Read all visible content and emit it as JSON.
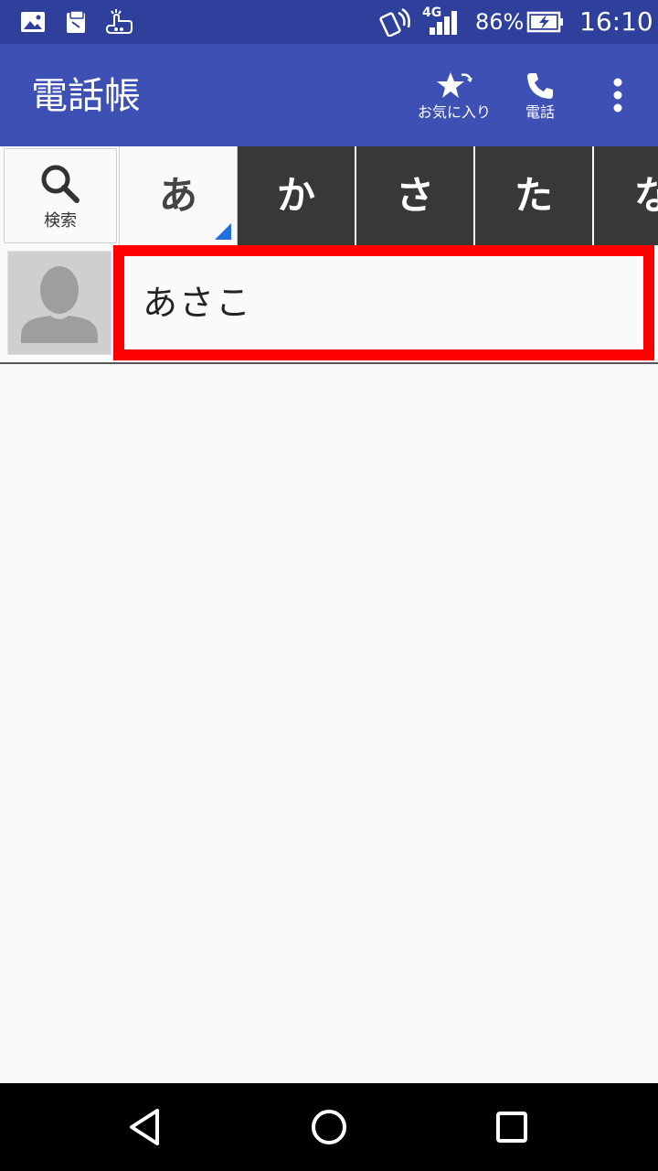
{
  "status": {
    "battery": "86%",
    "network": "4G",
    "time": "16:10"
  },
  "appbar": {
    "title": "電話帳",
    "favorites_label": "お気に入り",
    "phone_label": "電話"
  },
  "index": {
    "search_label": "検索",
    "tabs": [
      "あ",
      "か",
      "さ",
      "た",
      "な"
    ]
  },
  "contacts": [
    {
      "name": "あさこ"
    }
  ],
  "colors": {
    "status_bar": "#2e3f9c",
    "app_bar": "#3d51b5",
    "tab_inactive": "#383838",
    "highlight": "#fe0000",
    "active_marker": "#1f6fe0"
  }
}
